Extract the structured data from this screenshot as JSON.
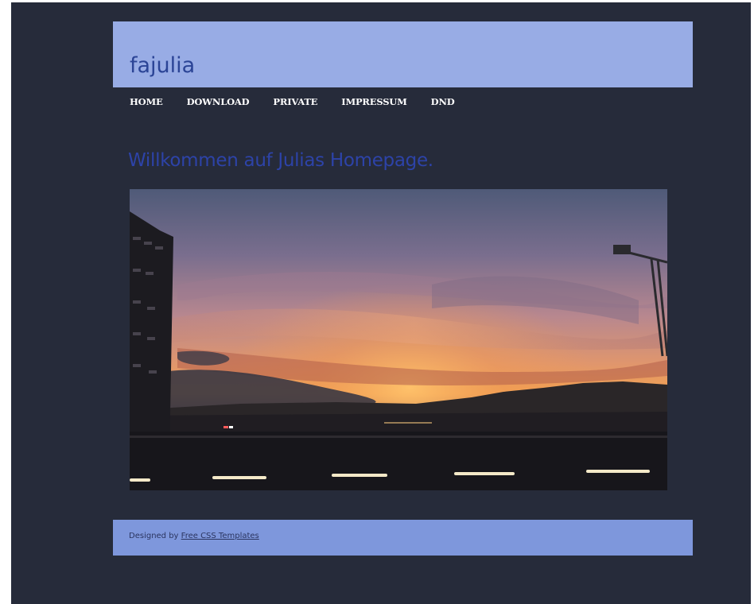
{
  "site": {
    "title": "fajulia"
  },
  "nav": {
    "items": [
      {
        "label": "HOME"
      },
      {
        "label": "DOWNLOAD"
      },
      {
        "label": "PRIVATE"
      },
      {
        "label": "IMPRESSUM"
      },
      {
        "label": "DND"
      }
    ]
  },
  "main": {
    "headline": "Willkommen auf Julias Homepage."
  },
  "footer": {
    "prefix": "Designed by",
    "link_label": "Free CSS Templates"
  },
  "colors": {
    "page_background": "#262b3a",
    "header_background": "#98ace5",
    "title_color": "#2b4496",
    "headline_color": "#2d43a8",
    "footer_background": "#7e97dc"
  }
}
